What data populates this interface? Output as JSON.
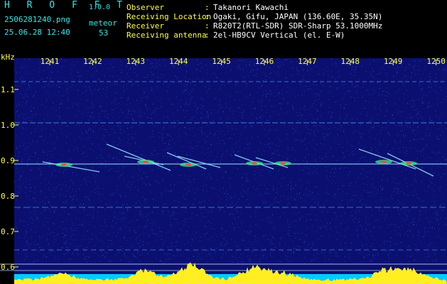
{
  "app": {
    "name": "H R O F F T",
    "version": "1.0.0"
  },
  "file": {
    "name": "2506281240.png",
    "datetime": "25.06.28 12:40"
  },
  "detection": {
    "mode": "meteor",
    "count": "53"
  },
  "station": [
    {
      "label": "Observer",
      "value": "Takanori Kawachi"
    },
    {
      "label": "Receiving Location",
      "value": "Ogaki, Gifu, JAPAN (136.60E, 35.35N)"
    },
    {
      "label": "Receiver",
      "value": "R820T2(RTL-SDR) SDR-Sharp 53.1000MHz"
    },
    {
      "label": "Receiving antenna",
      "value": "2el-HB9CV Vertical (el. E-W)"
    }
  ],
  "spectrogram": {
    "unit_label": "kHz",
    "x_labels": [
      "1241",
      "1242",
      "1243",
      "1244",
      "1245",
      "1246",
      "1247",
      "1248",
      "1249",
      "1250"
    ],
    "y_labels": [
      "1.1",
      "1.0",
      "0.9",
      "0.8",
      "0.7",
      "0.6"
    ],
    "colors": {
      "background": "#0b1070",
      "text": "#ffff44",
      "header_label": "#33e6e6",
      "power_bar": "#ffee22",
      "baseline": "#00ccff"
    }
  }
}
